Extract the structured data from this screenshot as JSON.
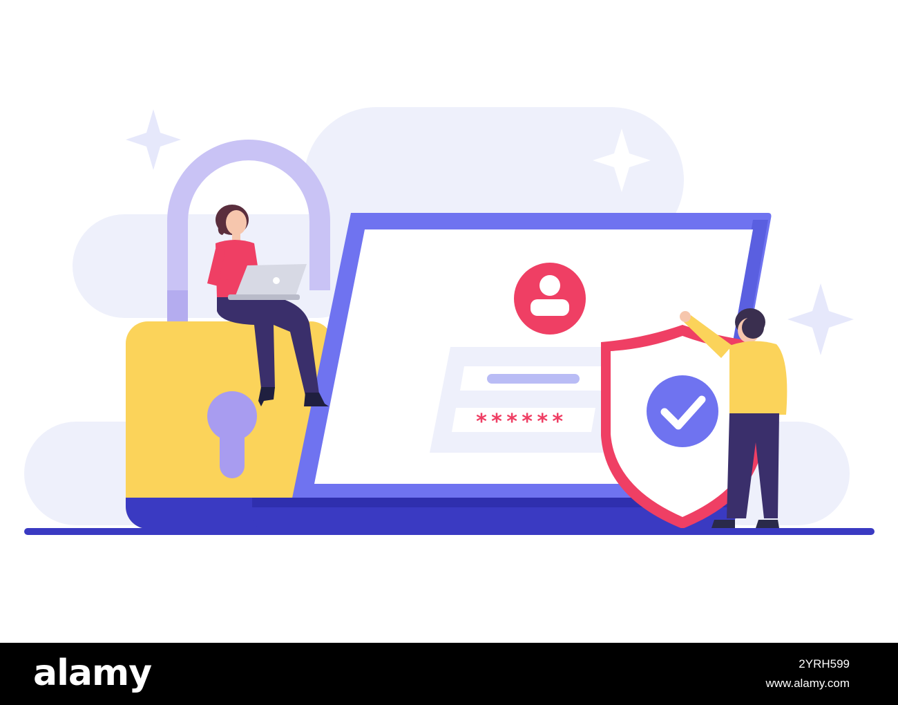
{
  "login_form": {
    "password_mask": "******"
  },
  "footer": {
    "logo_text": "alamy",
    "image_id": "2YRH599",
    "site": "www.alamy.com"
  },
  "colors": {
    "background_cloud": "#eef0fb",
    "laptop_frame": "#6f73f0",
    "laptop_base": "#3a3ac2",
    "padlock_body": "#fbd35a",
    "padlock_shackle": "#c9c3f5",
    "keyhole": "#a89cf0",
    "shield": "#ef3f64",
    "check_circle": "#6f73f0",
    "avatar_circle": "#ef3f64",
    "ground_line": "#3a3ac2"
  },
  "icons": {
    "user_avatar": "user-avatar-icon",
    "check": "check-icon",
    "shield": "shield-icon",
    "padlock": "padlock-icon",
    "sparkle": "sparkle-icon"
  }
}
